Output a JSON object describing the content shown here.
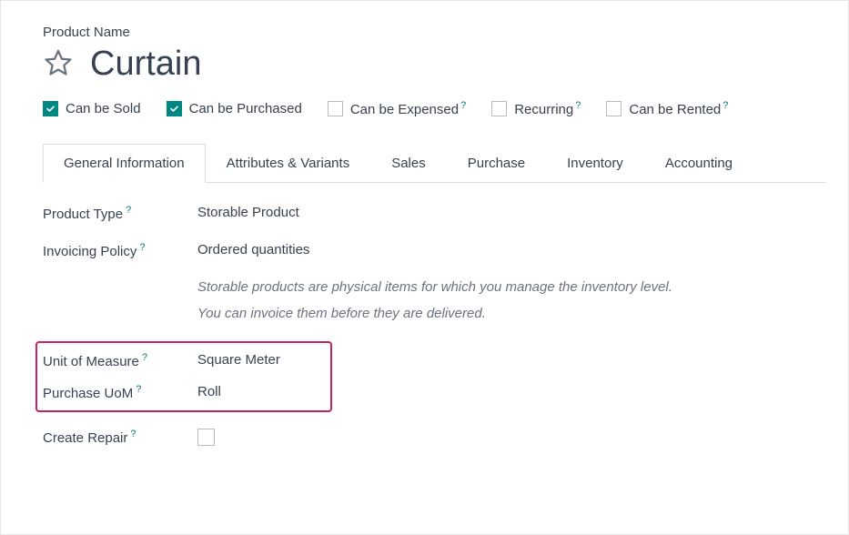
{
  "header": {
    "product_name_label": "Product Name",
    "product_title": "Curtain"
  },
  "checkboxes": {
    "can_be_sold": {
      "label": "Can be Sold",
      "checked": true,
      "help": false
    },
    "can_be_purchased": {
      "label": "Can be Purchased",
      "checked": true,
      "help": false
    },
    "can_be_expensed": {
      "label": "Can be Expensed",
      "checked": false,
      "help": true
    },
    "recurring": {
      "label": "Recurring",
      "checked": false,
      "help": true
    },
    "can_be_rented": {
      "label": "Can be Rented",
      "checked": false,
      "help": true
    }
  },
  "tabs": {
    "general_information": "General Information",
    "attributes_variants": "Attributes & Variants",
    "sales": "Sales",
    "purchase": "Purchase",
    "inventory": "Inventory",
    "accounting": "Accounting"
  },
  "fields": {
    "product_type": {
      "label": "Product Type",
      "value": "Storable Product"
    },
    "invoicing_policy": {
      "label": "Invoicing Policy",
      "value": "Ordered quantities"
    },
    "desc_line1": "Storable products are physical items for which you manage the inventory level.",
    "desc_line2": "You can invoice them before they are delivered.",
    "unit_of_measure": {
      "label": "Unit of Measure",
      "value": "Square Meter"
    },
    "purchase_uom": {
      "label": "Purchase UoM",
      "value": "Roll"
    },
    "create_repair": {
      "label": "Create Repair"
    }
  },
  "help_mark": "?"
}
